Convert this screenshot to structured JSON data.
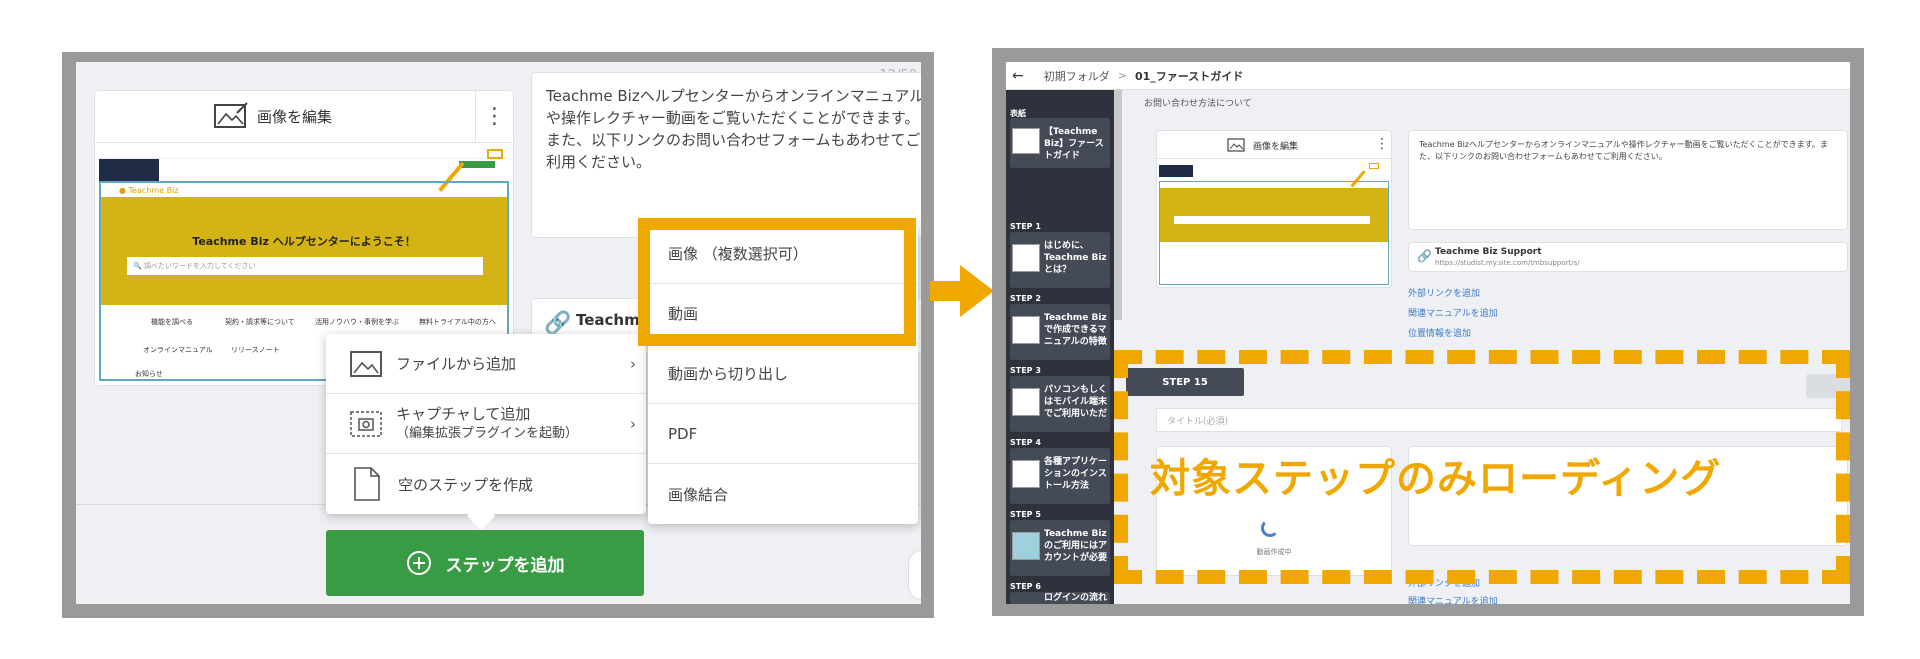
{
  "left": {
    "counter": "12/50",
    "edit_image_label": "画像を編集",
    "description": "Teachme Bizヘルプセンターからオンラインマニュアルや操作レクチャー動画をご覧いただくことができます。また、以下リンクのお問い合わせフォームもあわせてご利用ください。",
    "link_title": "Teachm",
    "mini": {
      "logo": "● Teachme Biz",
      "banner": "Teachme Biz ヘルプセンターにようこそ！",
      "search": "調べたいワードを入力してください",
      "cats": [
        "機能を調べる",
        "契約・請求等について",
        "活用ノウハウ・事例を学ぶ",
        "無料トライアル中の方へ",
        "オンラインマニュアル",
        "リリースノート"
      ],
      "notice": "お知らせ"
    },
    "add_menu": [
      {
        "label": "ファイルから追加",
        "sub": ""
      },
      {
        "label": "キャプチャして追加",
        "sub": "（編集拡張プラグインを起動）"
      },
      {
        "label": "空のステップを作成",
        "sub": ""
      }
    ],
    "submenu": [
      "画像 （複数選択可）",
      "動画",
      "動画から切り出し",
      "PDF",
      "画像結合"
    ],
    "add_step_label": "ステップを追加"
  },
  "right": {
    "breadcrumb_parent": "初期フォルダ",
    "breadcrumb_sep": ">",
    "breadcrumb_current": "01_ファーストガイド",
    "top_text": "お問い合わせ方法について",
    "cover": {
      "label": "表紙",
      "title": "【Teachme Biz】ファーストガイド"
    },
    "steps": [
      {
        "label": "STEP 1",
        "title": "はじめに、Teachme Bizとは？"
      },
      {
        "label": "STEP 2",
        "title": "Teachme Bizで作成できるマニュアルの特徴"
      },
      {
        "label": "STEP 3",
        "title": "パソコンもしくはモバイル端末でご利用いただ"
      },
      {
        "label": "STEP 4",
        "title": "各種アプリケーションのインストール方法"
      },
      {
        "label": "STEP 5",
        "title": "Teachme Bizのご利用にはアカウントが必要"
      },
      {
        "label": "STEP 6",
        "title": "ログインの流れ"
      }
    ],
    "edit_image_label": "画像を編集",
    "description": "Teachme Bizヘルプセンターからオンラインマニュアルや操作レクチャー動画をご覧いただくことができます。また、以下リンクのお問い合わせフォームもあわせてご利用ください。",
    "link_title": "Teachme Biz Support",
    "link_url": "https://studist.my.site.com/tmbsupport/s/",
    "links": [
      "外部リンクを追加",
      "関連マニュアルを追加",
      "位置情報を追加"
    ],
    "step_badge": "STEP 15",
    "title_placeholder": "タイトル(必須)",
    "loading_text": "動画作成中",
    "overlay_text": "対象ステップのみローディング",
    "bottom_links": [
      "外部リンクを追加",
      "関連マニュアルを追加"
    ]
  },
  "colors": {
    "accent": "#f0a800",
    "green": "#3a9b45",
    "sidebar": "#2e323c",
    "frame": "#9a9a9a"
  }
}
